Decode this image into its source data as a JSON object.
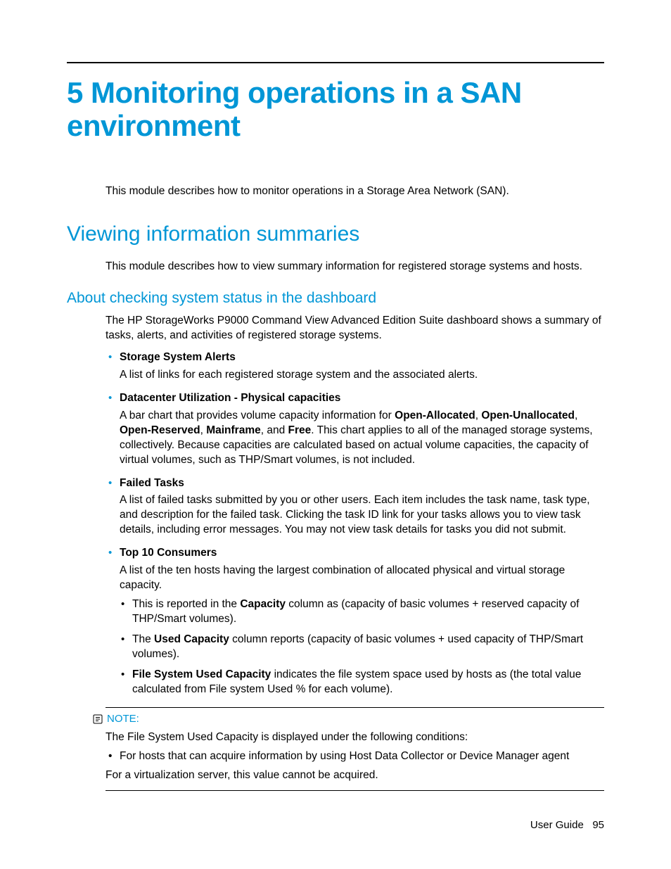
{
  "chapter_title": "5 Monitoring operations in a SAN environment",
  "intro": "This module describes how to monitor operations in a Storage Area Network (SAN).",
  "section": {
    "title": "Viewing information summaries",
    "intro": "This module describes how to view summary information for registered storage systems and hosts."
  },
  "subsection": {
    "title": "About checking system status in the dashboard",
    "intro": "The HP StorageWorks P9000 Command View Advanced Edition Suite dashboard shows a summary of tasks, alerts, and activities of registered storage systems.",
    "bullets": [
      {
        "head": "Storage System Alerts",
        "body": "A list of links for each registered storage system and the associated alerts."
      },
      {
        "head": "Datacenter Utilization - Physical capacities",
        "body_pre": "A bar chart that provides volume capacity information for ",
        "b1": "Open-Allocated",
        "s1": ", ",
        "b2": "Open-Unallocated",
        "s2": ", ",
        "b3": "Open-Reserved",
        "s3": ", ",
        "b4": "Mainframe",
        "s4": ", and ",
        "b5": "Free",
        "body_post": ". This chart applies to all of the managed storage systems, collectively. Because capacities are calculated based on actual volume capacities, the capacity of virtual volumes, such as THP/Smart volumes, is not included."
      },
      {
        "head": "Failed Tasks",
        "body": "A list of failed tasks submitted by you or other users. Each item includes the task name, task type, and description for the failed task. Clicking the task ID link for your tasks allows you to view task details, including error messages. You may not view task details for tasks you did not submit."
      },
      {
        "head": "Top 10 Consumers",
        "body": "A list of the ten hosts having the largest combination of allocated physical and virtual storage capacity.",
        "sub": [
          {
            "pre": "This is reported in the ",
            "b": "Capacity",
            "post": " column as (capacity of basic volumes + reserved capacity of THP/Smart volumes)."
          },
          {
            "pre": "The ",
            "b": "Used Capacity",
            "post": " column reports (capacity of basic volumes + used capacity of THP/Smart volumes)."
          },
          {
            "pre": "",
            "b": "File System Used Capacity",
            "post": " indicates the file system space used by hosts as (the total value calculated from File system Used % for each volume)."
          }
        ]
      }
    ]
  },
  "note": {
    "label": "NOTE:",
    "line1": "The File System Used Capacity is displayed under the following conditions:",
    "items": [
      "For hosts that can acquire information by using Host Data Collector or Device Manager agent"
    ],
    "line2": "For a virtualization server, this value cannot be acquired."
  },
  "footer": {
    "doc": "User Guide",
    "page": "95"
  }
}
